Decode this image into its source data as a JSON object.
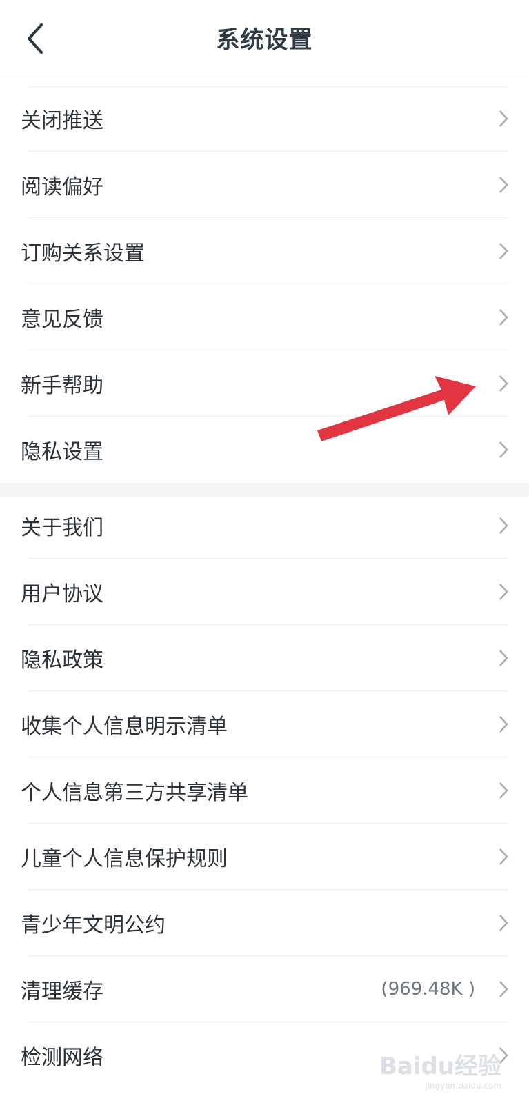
{
  "header": {
    "title": "系统设置",
    "back_icon": "chevron-left-icon"
  },
  "group1": {
    "items": [
      {
        "label": "关闭推送"
      },
      {
        "label": "阅读偏好"
      },
      {
        "label": "订购关系设置"
      },
      {
        "label": "意见反馈"
      },
      {
        "label": "新手帮助"
      },
      {
        "label": "隐私设置"
      }
    ]
  },
  "group2": {
    "items": [
      {
        "label": "关于我们"
      },
      {
        "label": "用户协议"
      },
      {
        "label": "隐私政策"
      },
      {
        "label": "收集个人信息明示清单"
      },
      {
        "label": "个人信息第三方共享清单"
      },
      {
        "label": "儿童个人信息保护规则"
      },
      {
        "label": "青少年文明公约"
      },
      {
        "label": "清理缓存",
        "value": "(969.48K )"
      },
      {
        "label": "检测网络"
      }
    ]
  },
  "annotation": {
    "arrow_color": "#e23542"
  },
  "watermark": {
    "text": "Baidu经验",
    "subtext": "jingyan.baidu.com"
  },
  "colors": {
    "title": "#303a45",
    "text": "#2d3238",
    "chevron": "#a9adb2",
    "divider": "#efefef",
    "section_gap": "#f4f4f4"
  }
}
